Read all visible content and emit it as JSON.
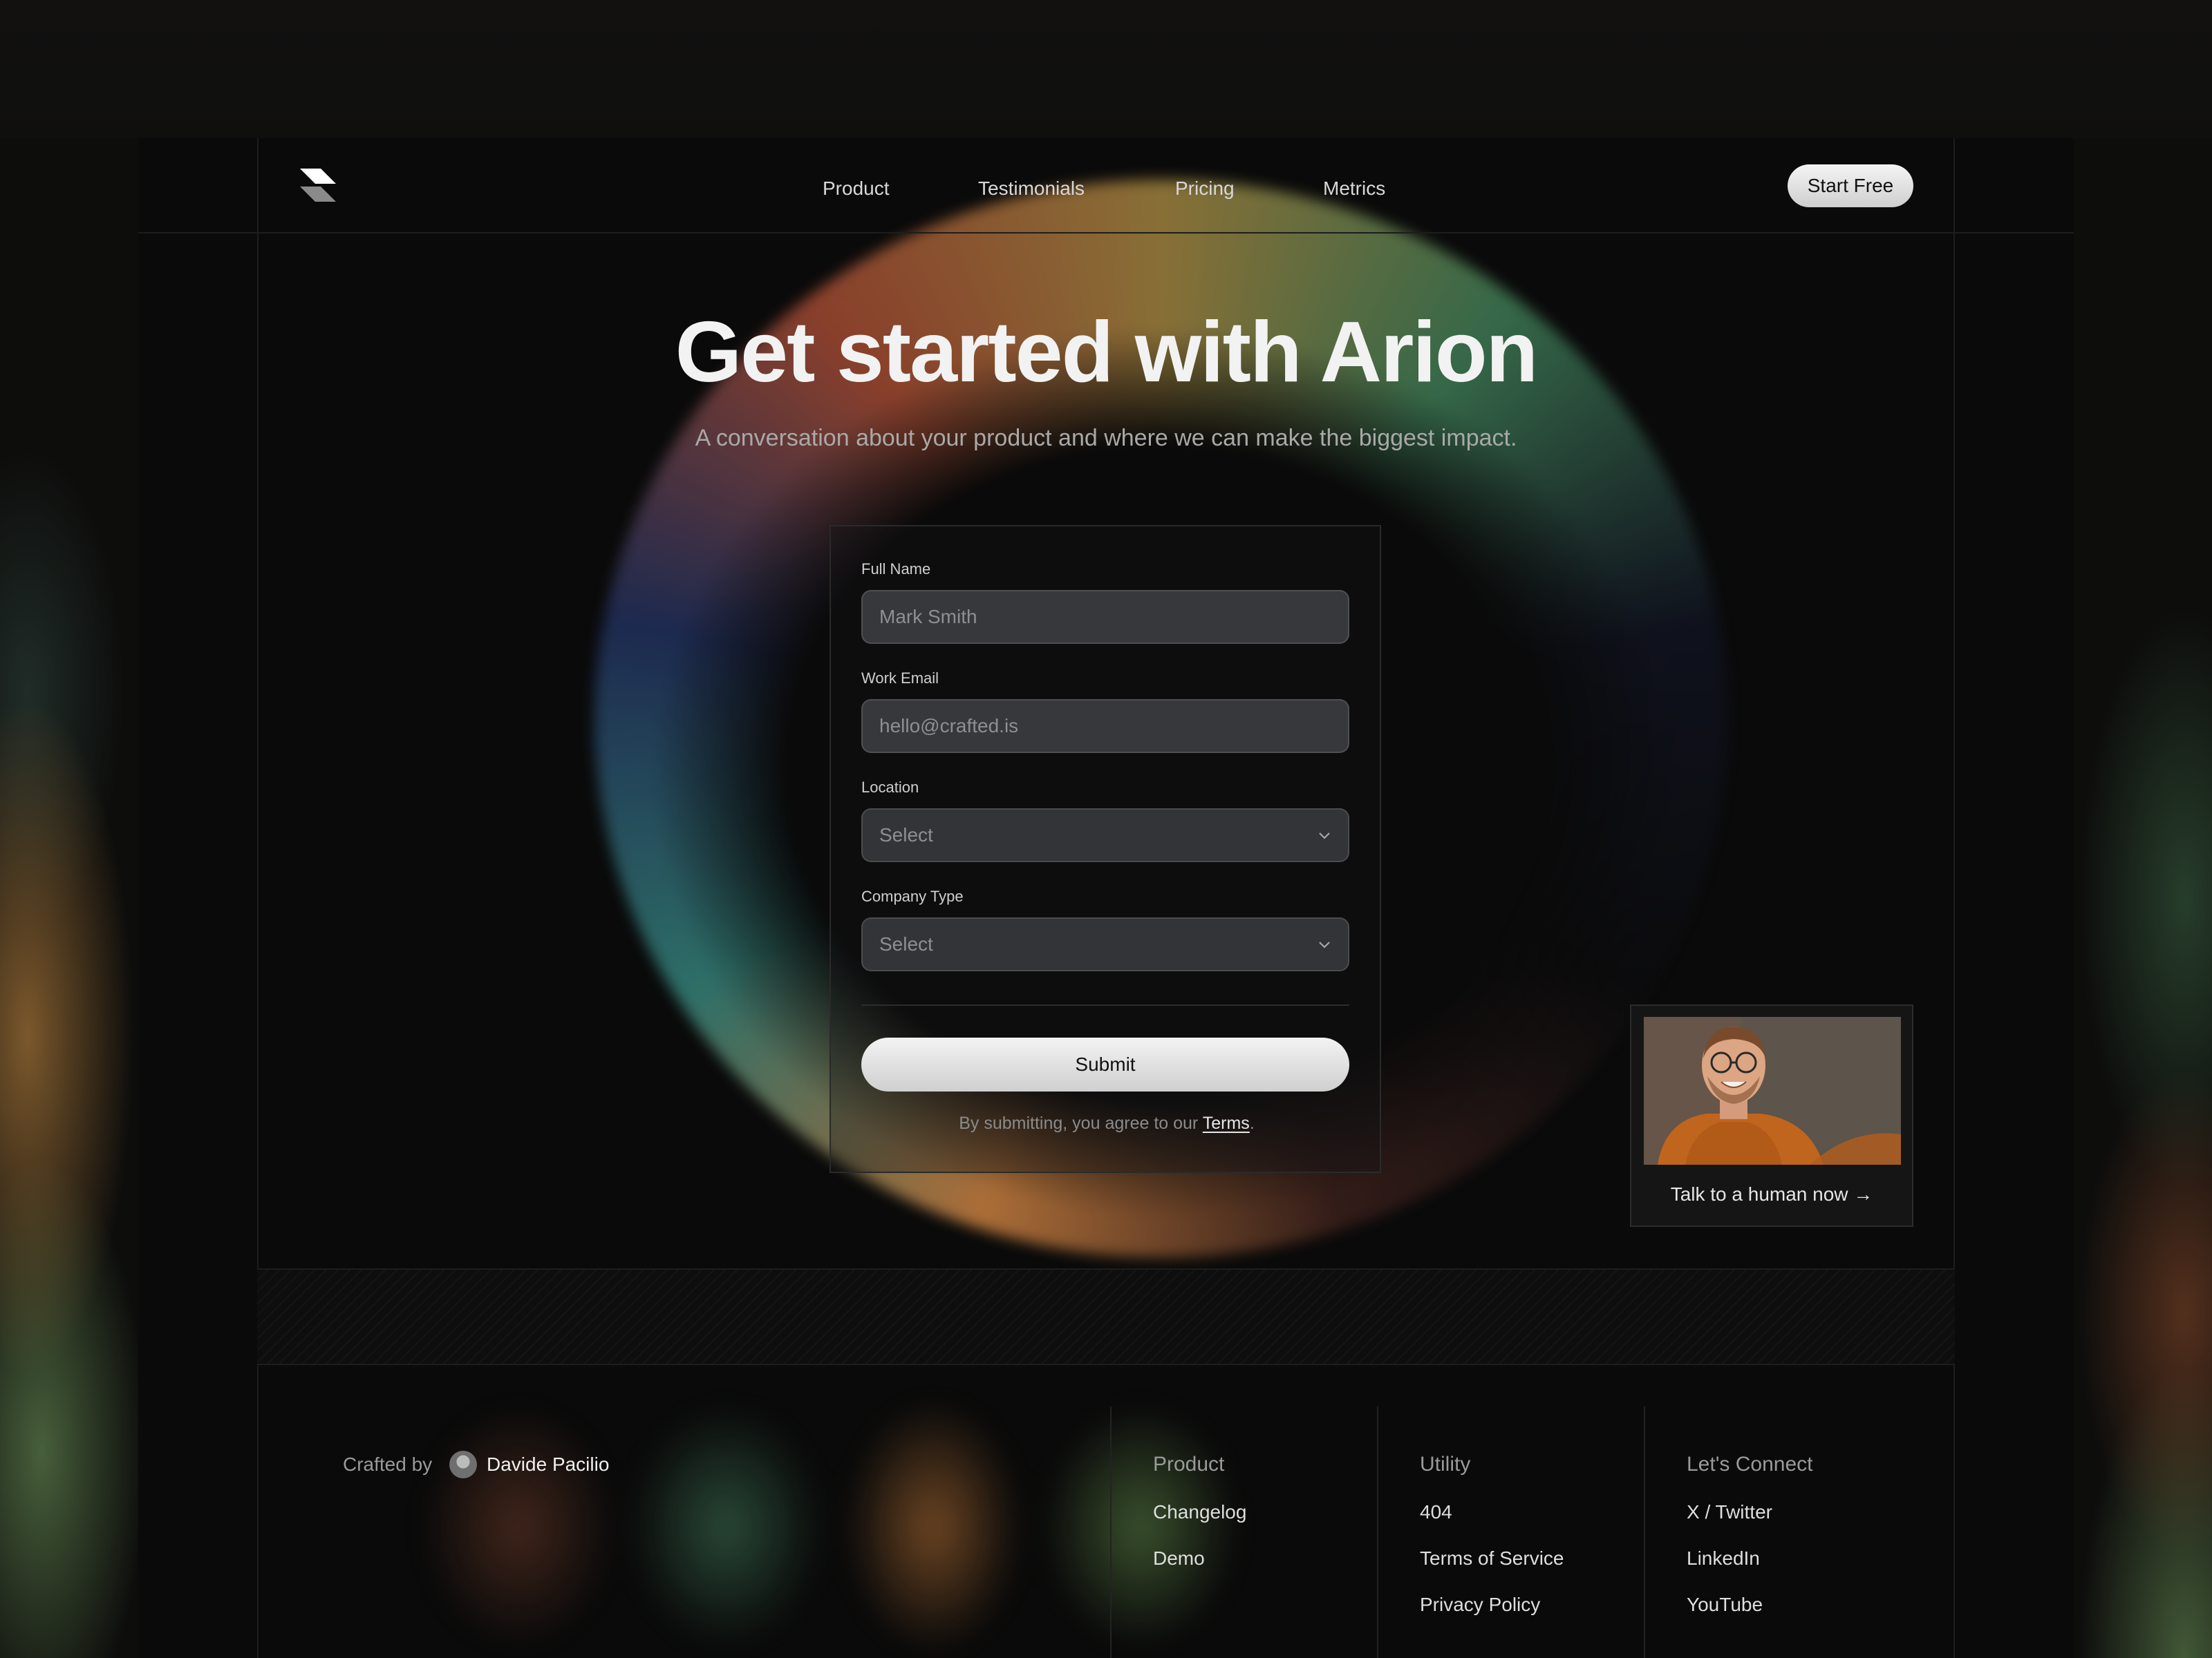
{
  "nav": {
    "links": [
      "Product",
      "Testimonials",
      "Pricing",
      "Metrics"
    ],
    "cta_label": "Start Free"
  },
  "hero": {
    "title": "Get started with Arion",
    "subtitle": "A conversation about your product and where we can make the biggest impact."
  },
  "form": {
    "full_name": {
      "label": "Full Name",
      "placeholder": "Mark Smith"
    },
    "work_email": {
      "label": "Work Email",
      "placeholder": "hello@crafted.is"
    },
    "location": {
      "label": "Location",
      "placeholder": "Select"
    },
    "company_type": {
      "label": "Company Type",
      "placeholder": "Select"
    },
    "submit_label": "Submit",
    "terms_prefix": "By submitting, you agree to our ",
    "terms_link": "Terms",
    "terms_suffix": "."
  },
  "human_card": {
    "cta": "Talk to a human now →"
  },
  "footer": {
    "crafted_by": "Crafted by",
    "author": "Davide Pacilio",
    "columns": [
      {
        "heading": "Product",
        "links": [
          "Changelog",
          "Demo"
        ]
      },
      {
        "heading": "Utility",
        "links": [
          "404",
          "Terms of Service",
          "Privacy Policy"
        ]
      },
      {
        "heading": "Let's Connect",
        "links": [
          "X / Twitter",
          "LinkedIn",
          "YouTube"
        ]
      }
    ]
  },
  "colors": {
    "background": "#0a0a0a",
    "button_light": "#e8e8e8",
    "input_fill": "#5a5c60"
  }
}
